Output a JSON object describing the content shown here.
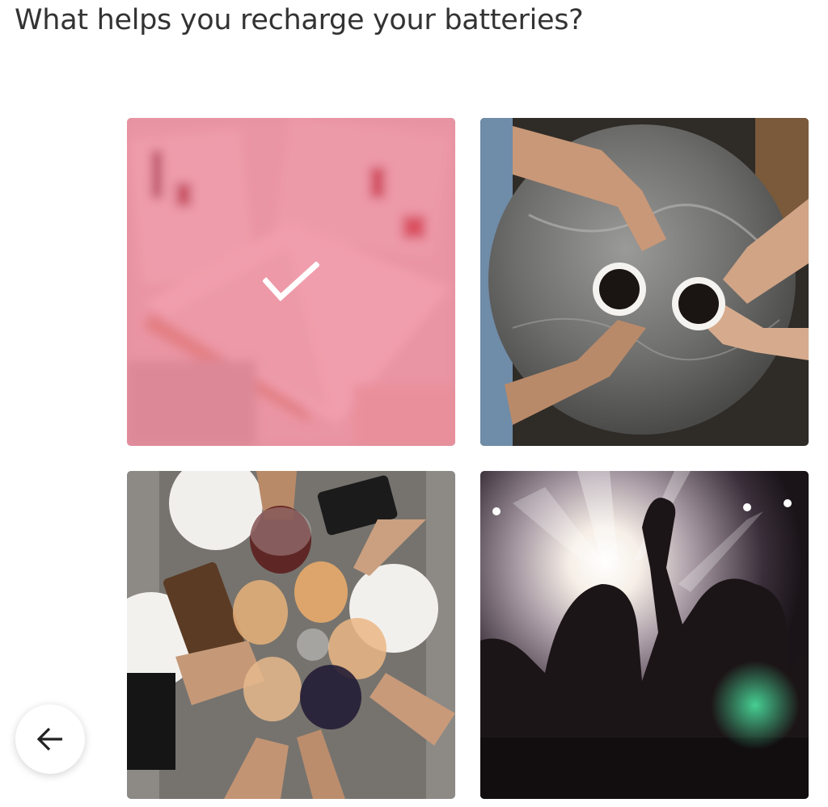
{
  "question": {
    "title": "What helps you recharge your batteries?"
  },
  "options": [
    {
      "id": "reading",
      "image": "open-book-photo",
      "selected": true
    },
    {
      "id": "coffee",
      "image": "coffee-with-friends-photo",
      "selected": false
    },
    {
      "id": "toast",
      "image": "wine-glass-toast-photo",
      "selected": false
    },
    {
      "id": "concert",
      "image": "concert-crowd-photo",
      "selected": false
    }
  ],
  "selection": {
    "icon": "checkmark-icon",
    "overlay_color": "#eb5a78"
  },
  "navigation": {
    "back_icon": "arrow-left-icon"
  }
}
